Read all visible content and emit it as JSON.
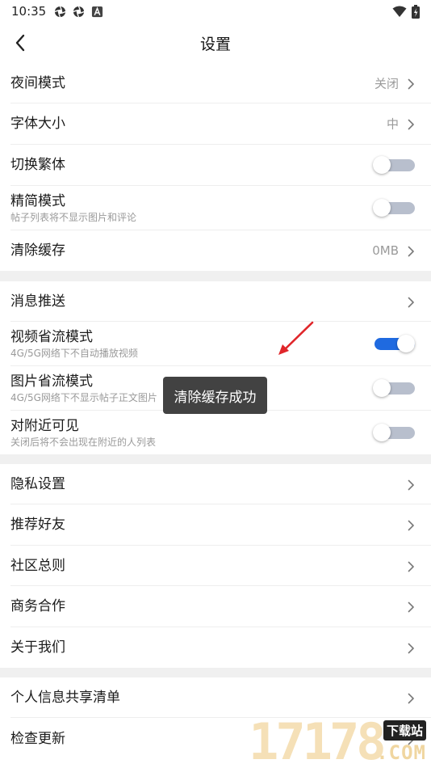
{
  "status_bar": {
    "time": "10:35",
    "icons": [
      "app-icon",
      "app-icon",
      "notification-a-icon"
    ],
    "right_icons": [
      "wifi-icon",
      "battery-charging-icon"
    ]
  },
  "header": {
    "title": "设置",
    "back_icon": "chevron-left-icon"
  },
  "groups": [
    {
      "items": [
        {
          "label": "夜间模式",
          "value": "关闭",
          "control": "chevron"
        },
        {
          "label": "字体大小",
          "value": "中",
          "control": "chevron"
        },
        {
          "label": "切换繁体",
          "control": "toggle",
          "on": false
        },
        {
          "label": "精简模式",
          "subtitle": "帖子列表将不显示图片和评论",
          "control": "toggle",
          "on": false
        },
        {
          "label": "清除缓存",
          "value": "0MB",
          "control": "chevron"
        }
      ]
    },
    {
      "items": [
        {
          "label": "消息推送",
          "control": "chevron"
        },
        {
          "label": "视频省流模式",
          "subtitle": "4G/5G网络下不自动播放视频",
          "control": "toggle",
          "on": true
        },
        {
          "label": "图片省流模式",
          "subtitle": "4G/5G网络下不显示帖子正文图片",
          "control": "toggle",
          "on": false
        },
        {
          "label": "对附近可见",
          "subtitle": "关闭后将不会出现在附近的人列表",
          "control": "toggle",
          "on": false
        }
      ]
    },
    {
      "items": [
        {
          "label": "隐私设置",
          "control": "chevron"
        },
        {
          "label": "推荐好友",
          "control": "chevron"
        },
        {
          "label": "社区总则",
          "control": "chevron"
        },
        {
          "label": "商务合作",
          "control": "chevron"
        },
        {
          "label": "关于我们",
          "control": "chevron"
        }
      ]
    },
    {
      "items": [
        {
          "label": "个人信息共享清单",
          "control": "chevron"
        },
        {
          "label": "检查更新",
          "control": "chevron"
        }
      ]
    }
  ],
  "toast": {
    "text": "清除缓存成功"
  },
  "watermark": {
    "number": "17178",
    "badge": "下载站",
    "suffix": ".COM"
  },
  "colors": {
    "accent": "#1f6ae0",
    "toggle_off": "#b8bfcd",
    "annotation_arrow": "#e0262a",
    "toast_bg": "#424242"
  }
}
